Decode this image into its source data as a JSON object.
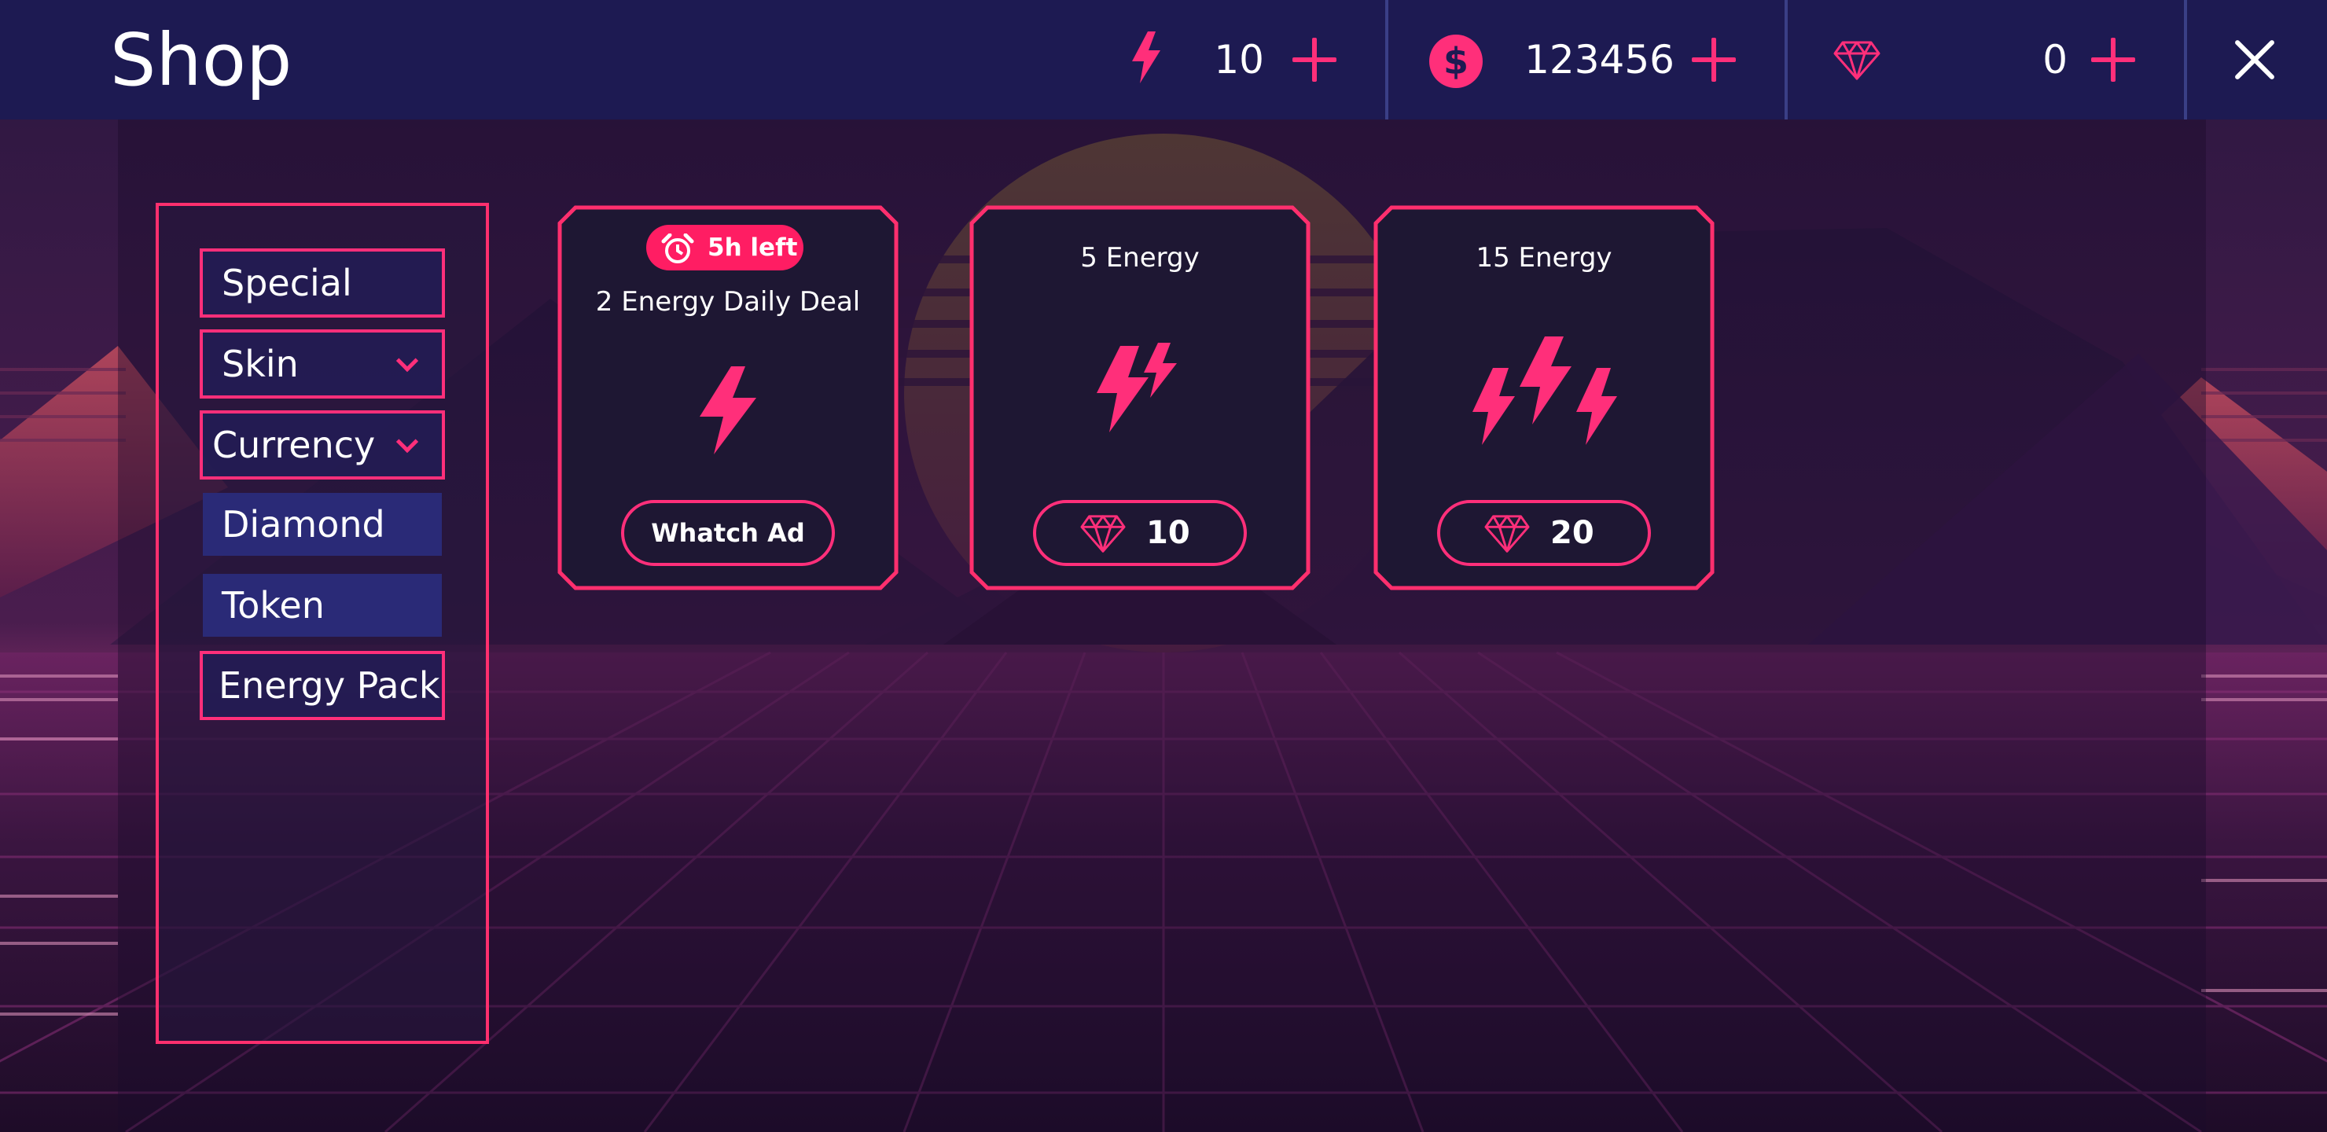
{
  "header": {
    "title": "Shop",
    "energy": "10",
    "coins": "123456",
    "diamonds": "0"
  },
  "sidebar": {
    "items": [
      {
        "label": "Special",
        "style": "outlined"
      },
      {
        "label": "Skin",
        "style": "outlined",
        "expandable": true
      },
      {
        "label": "Currency",
        "style": "outlined",
        "expandable": true
      },
      {
        "label": "Diamond",
        "style": "sub"
      },
      {
        "label": "Token",
        "style": "sub"
      },
      {
        "label": "Energy Pack",
        "style": "outlined"
      }
    ]
  },
  "cards": [
    {
      "badge": "5h left",
      "title": "2 Energy Daily Deal",
      "button": "Whatch Ad",
      "icon": "energy-bolt-icon"
    },
    {
      "title": "5 Energy",
      "price": "10",
      "icon": "double-bolt-icon"
    },
    {
      "title": "15 Energy",
      "price": "20",
      "icon": "triple-bolt-icon"
    }
  ],
  "colors": {
    "accent": "#ff2f7a",
    "topbar": "#1d1a52",
    "panel": "#2a1a3d",
    "sub_item": "#2a2a77"
  }
}
